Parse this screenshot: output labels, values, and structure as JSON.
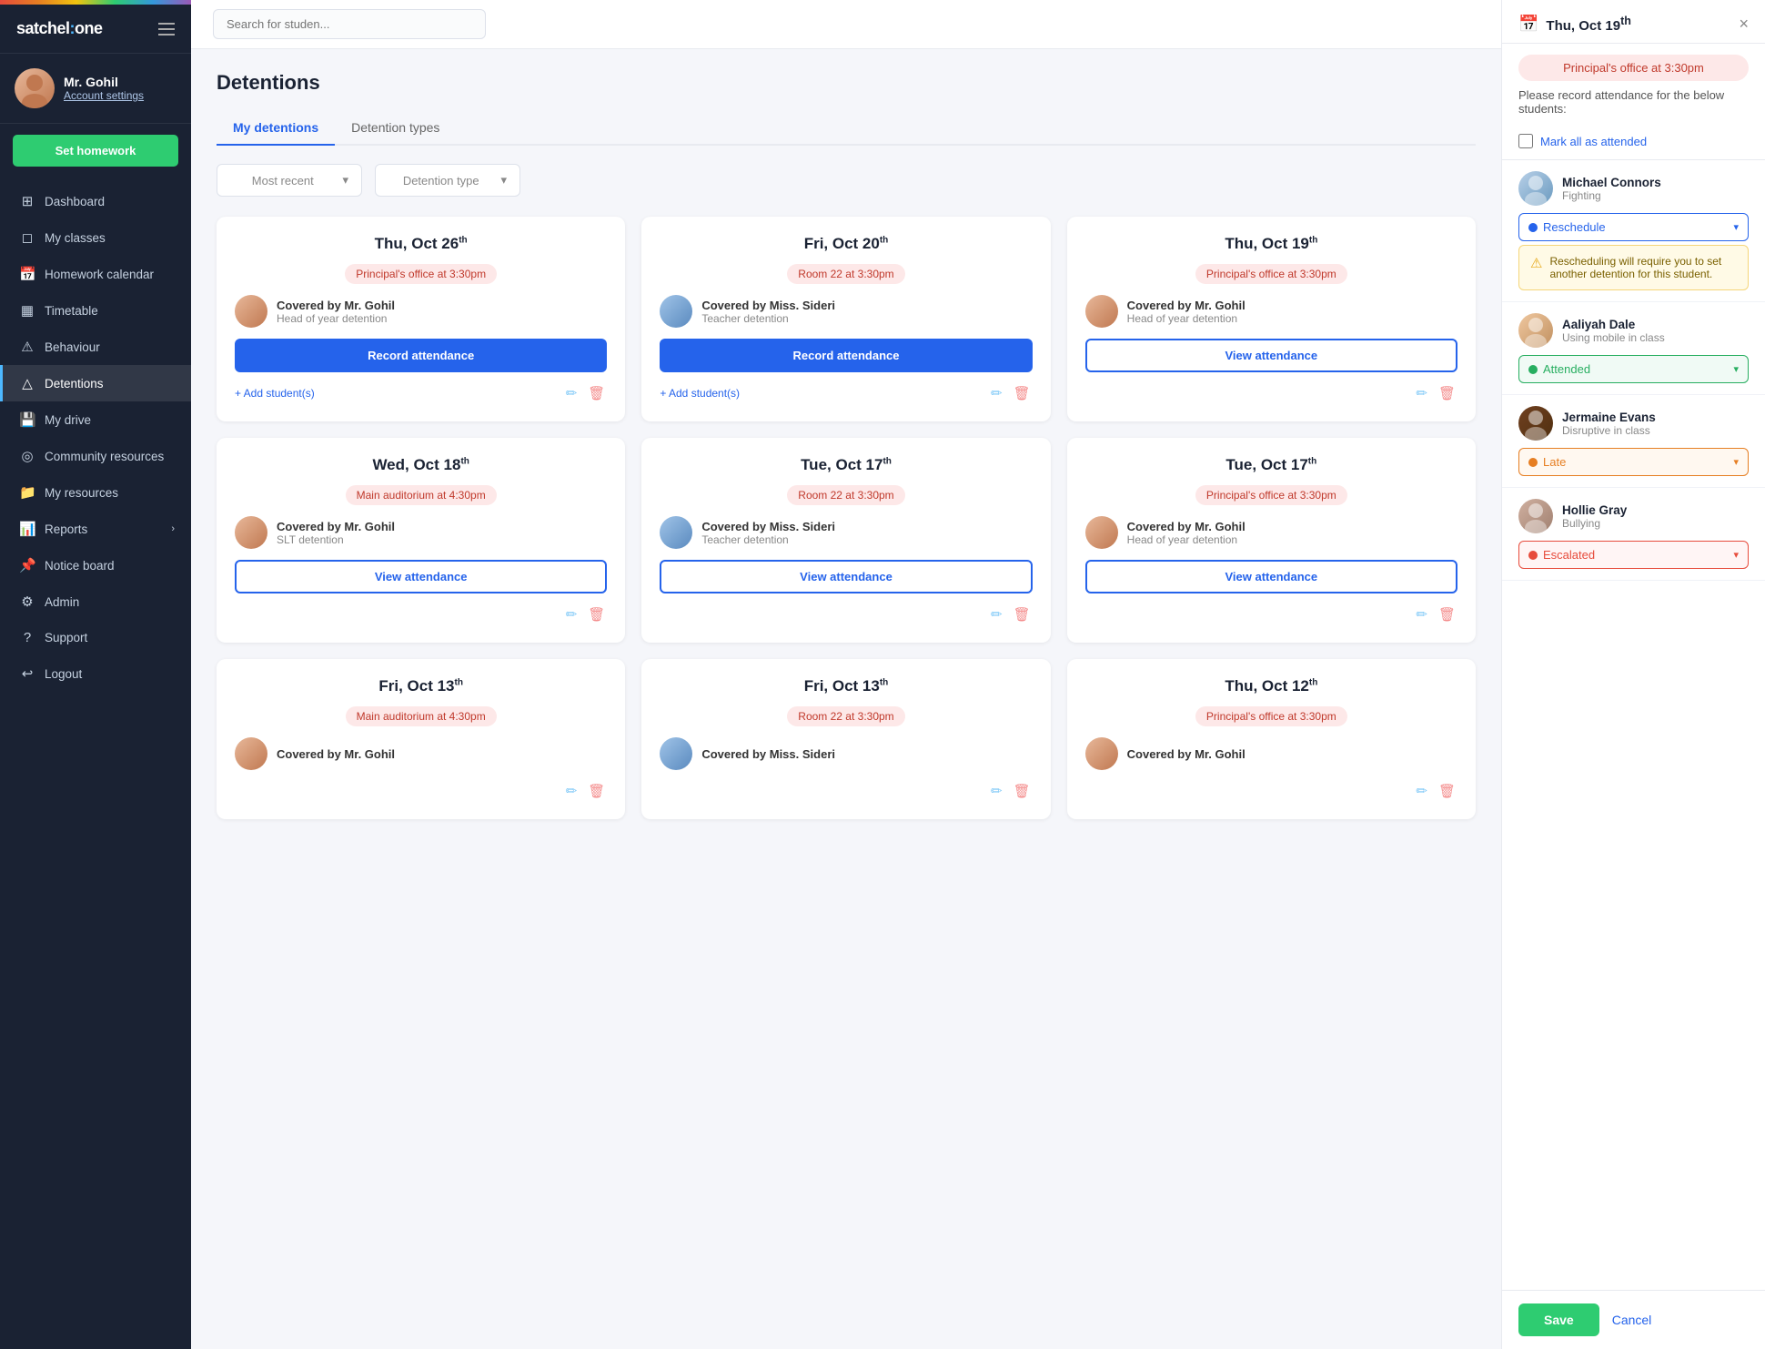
{
  "app": {
    "name": "satchel",
    "name2": "one"
  },
  "sidebar": {
    "user": {
      "name": "Mr. Gohil",
      "settings_label": "Account settings"
    },
    "set_homework_label": "Set homework",
    "nav": [
      {
        "id": "dashboard",
        "label": "Dashboard",
        "icon": "⊞"
      },
      {
        "id": "my-classes",
        "label": "My classes",
        "icon": "◻"
      },
      {
        "id": "homework-calendar",
        "label": "Homework calendar",
        "icon": "📅"
      },
      {
        "id": "timetable",
        "label": "Timetable",
        "icon": "▦"
      },
      {
        "id": "behaviour",
        "label": "Behaviour",
        "icon": "⚠"
      },
      {
        "id": "detentions",
        "label": "Detentions",
        "icon": "△",
        "active": true
      },
      {
        "id": "my-drive",
        "label": "My drive",
        "icon": "💾"
      },
      {
        "id": "community-resources",
        "label": "Community resources",
        "icon": "◎"
      },
      {
        "id": "my-resources",
        "label": "My resources",
        "icon": "📁"
      },
      {
        "id": "reports",
        "label": "Reports",
        "icon": "📊",
        "has_chevron": true
      },
      {
        "id": "notice-board",
        "label": "Notice board",
        "icon": "📌"
      },
      {
        "id": "admin",
        "label": "Admin",
        "icon": "⚙"
      },
      {
        "id": "support",
        "label": "Support",
        "icon": "?"
      },
      {
        "id": "logout",
        "label": "Logout",
        "icon": "↩"
      }
    ]
  },
  "topbar": {
    "search_placeholder": "Search for studen..."
  },
  "page": {
    "title": "Detentions"
  },
  "tabs": [
    {
      "label": "My detentions",
      "active": true
    },
    {
      "label": "Detention types",
      "active": false
    }
  ],
  "filters": [
    {
      "label": "Most recent",
      "id": "sort-filter"
    },
    {
      "label": "Detention type",
      "id": "type-filter"
    }
  ],
  "cards": [
    {
      "date": "Thu, Oct 26",
      "date_suffix": "th",
      "location": "Principal's office at 3:30pm",
      "teacher_name": "Covered by Mr. Gohil",
      "detention_type": "Head of year detention",
      "btn_type": "record",
      "btn_label": "Record attendance",
      "has_add_student": true,
      "teacher_av": "av-gohil"
    },
    {
      "date": "Fri, Oct 20",
      "date_suffix": "th",
      "location": "Room 22 at 3:30pm",
      "teacher_name": "Covered by Miss. Sideri",
      "detention_type": "Teacher detention",
      "btn_type": "record",
      "btn_label": "Record attendance",
      "has_add_student": true,
      "teacher_av": "av-sideri"
    },
    {
      "date": "Thu, Oct 19",
      "date_suffix": "th",
      "location": "Principal's office at 3:30pm",
      "teacher_name": "Covered by Mr. Gohil",
      "detention_type": "Head of year detention",
      "btn_type": "view",
      "btn_label": "View attendance",
      "has_add_student": false,
      "teacher_av": "av-gohil"
    },
    {
      "date": "Wed, Oct 18",
      "date_suffix": "th",
      "location": "Main auditorium at 4:30pm",
      "teacher_name": "Covered by Mr. Gohil",
      "detention_type": "SLT detention",
      "btn_type": "view",
      "btn_label": "View attendance",
      "has_add_student": false,
      "teacher_av": "av-gohil"
    },
    {
      "date": "Tue, Oct 17",
      "date_suffix": "th",
      "location": "Room 22 at 3:30pm",
      "teacher_name": "Covered by Miss. Sideri",
      "detention_type": "Teacher detention",
      "btn_type": "view",
      "btn_label": "View attendance",
      "has_add_student": false,
      "teacher_av": "av-sideri"
    },
    {
      "date": "Tue, Oct 17",
      "date_suffix": "th",
      "location": "Principal's office at 3:30pm",
      "teacher_name": "Covered by Mr. Gohil",
      "detention_type": "Head of year detention",
      "btn_type": "view",
      "btn_label": "View attendance",
      "has_add_student": false,
      "teacher_av": "av-gohil"
    },
    {
      "date": "Fri, Oct 13",
      "date_suffix": "th",
      "location": "Main auditorium at 4:30pm",
      "teacher_name": "Covered by Mr. Gohil",
      "detention_type": "",
      "btn_type": "none",
      "btn_label": "",
      "has_add_student": false,
      "teacher_av": "av-gohil",
      "partial": true
    },
    {
      "date": "Fri, Oct 13",
      "date_suffix": "th",
      "location": "Room 22 at 3:30pm",
      "teacher_name": "Covered by Miss. Sideri",
      "detention_type": "",
      "btn_type": "none",
      "btn_label": "",
      "has_add_student": false,
      "teacher_av": "av-sideri",
      "partial": true
    },
    {
      "date": "Thu, Oct 12",
      "date_suffix": "th",
      "location": "Principal's office at 3:30pm",
      "teacher_name": "Covered by Mr. Gohil",
      "detention_type": "",
      "btn_type": "none",
      "btn_label": "",
      "has_add_student": false,
      "teacher_av": "av-gohil",
      "partial": true
    }
  ],
  "panel": {
    "title": "Thu, Oct 19",
    "title_suffix": "th",
    "location_badge": "Principal's office at 3:30pm",
    "instructions": "Please record attendance for the below students:",
    "mark_all_label": "Mark all as attended",
    "close_label": "×",
    "students": [
      {
        "name": "Michael Connors",
        "reason": "Fighting",
        "status": "reschedule",
        "status_label": "Reschedule",
        "av_class": "av-michael",
        "warning": "Rescheduling will require you to set another detention for this student."
      },
      {
        "name": "Aaliyah Dale",
        "reason": "Using mobile in class",
        "status": "attended",
        "status_label": "Attended",
        "av_class": "av-aaliyah",
        "warning": ""
      },
      {
        "name": "Jermaine Evans",
        "reason": "Disruptive in class",
        "status": "late",
        "status_label": "Late",
        "av_class": "av-jermaine",
        "warning": ""
      },
      {
        "name": "Hollie Gray",
        "reason": "Bullying",
        "status": "escalated",
        "status_label": "Escalated",
        "av_class": "av-hollie",
        "warning": ""
      }
    ],
    "save_label": "Save",
    "cancel_label": "Cancel"
  }
}
